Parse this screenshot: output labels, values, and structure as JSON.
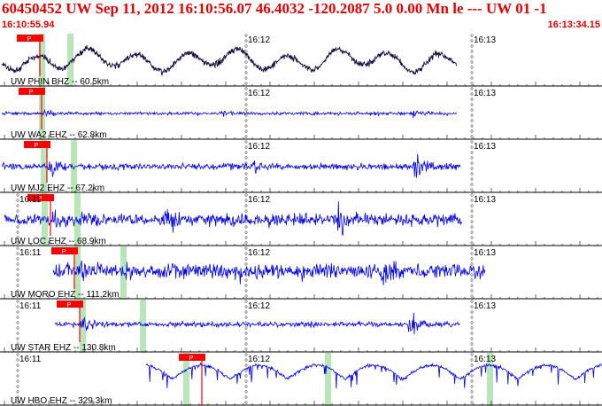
{
  "header": {
    "title": "60450452 UW Sep 11, 2012 16:10:56.07   46.4032 -120.2087  5.0 0.00 Mn le --- UW 01  -1",
    "start_time": "16:10:55.94",
    "end_time": "16:13:34.15"
  },
  "colors": {
    "header_text": "#e00000",
    "trace_first": "#1a0b40",
    "trace": "#0000e0",
    "pick_marker": "#ff0000",
    "window_band": "#b8e6b8",
    "grid": "#000000"
  },
  "panels": [
    {
      "label": "UW PHIN BHZ -- 60.5km",
      "time_labels": [
        "16:12",
        "16:13"
      ],
      "pick_label": "P"
    },
    {
      "label": "UW WA2 EHZ -- 62.8km",
      "time_labels": [
        "16:12",
        "16:13"
      ],
      "pick_label": "P"
    },
    {
      "label": "UW MJ2 EHZ -- 67.2km",
      "time_labels": [
        "16:12",
        "16:13"
      ],
      "pick_label": "P"
    },
    {
      "label": "UW LOC EHZ -- 68.9km",
      "time_labels": [
        "16:11",
        "16:12",
        "16:13"
      ],
      "pick_label": "P"
    },
    {
      "label": "UW MORO EHZ -- 111.2km",
      "time_labels": [
        "16:11",
        "16:12",
        "16:13"
      ],
      "pick_label": "P"
    },
    {
      "label": "UW STAR EHZ -- 130.8km",
      "time_labels": [
        "16:11",
        "16:12",
        "16:13"
      ],
      "pick_label": "P"
    },
    {
      "label": "UW HBO EHZ -- 329.3km",
      "time_labels": [
        "16:11",
        "16:12",
        "16:13"
      ],
      "pick_label": "P"
    }
  ]
}
